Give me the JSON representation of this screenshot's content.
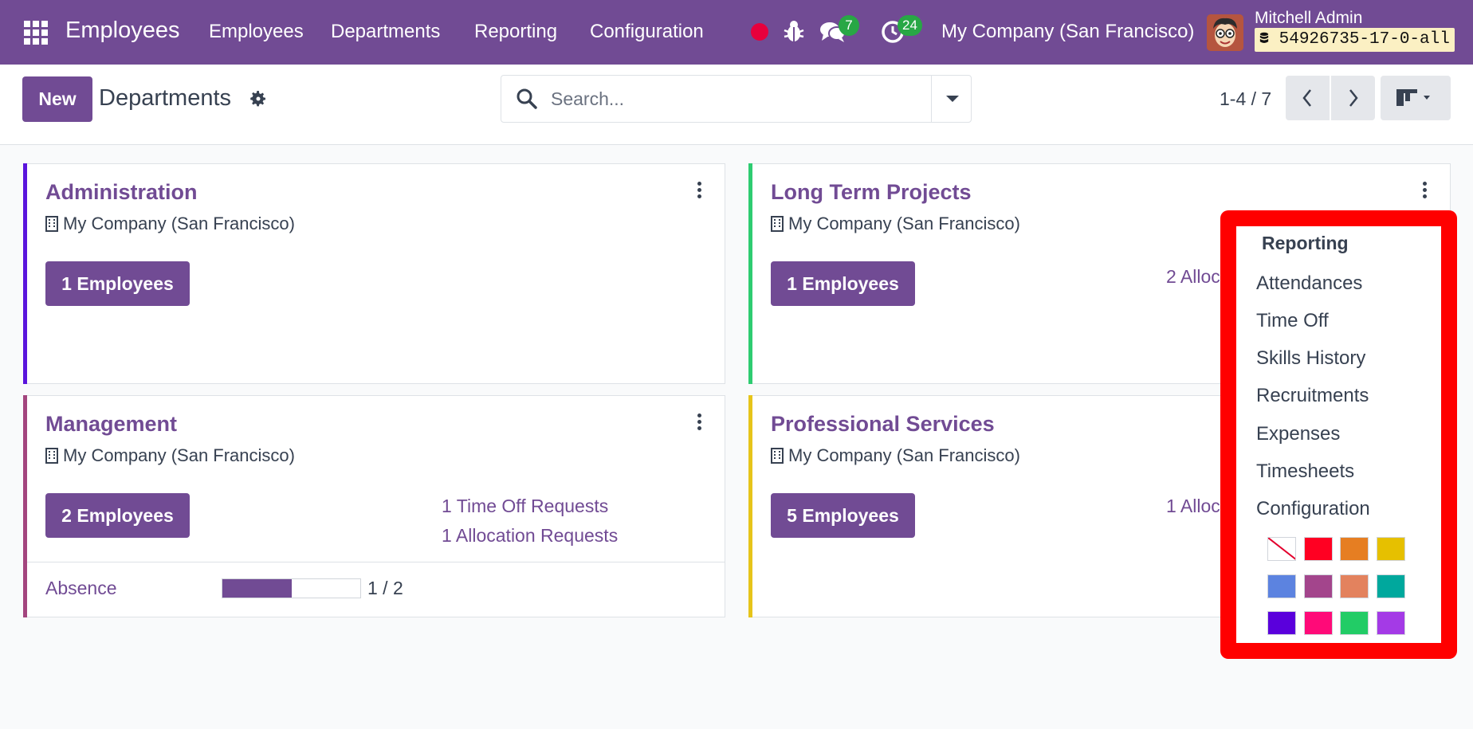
{
  "navbar": {
    "app_name": "Employees",
    "menu": [
      "Employees",
      "Departments",
      "Reporting",
      "Configuration"
    ],
    "messages_count": "7",
    "activities_count": "24",
    "company": "My Company (San Francisco)",
    "user_name": "Mitchell Admin",
    "database": "54926735-17-0-all",
    "icons": [
      "apps-icon",
      "record-dot-icon",
      "bug-icon",
      "chat-icon",
      "clock-icon",
      "database-icon"
    ]
  },
  "control_panel": {
    "new_label": "New",
    "title": "Departments",
    "search_placeholder": "Search...",
    "pager": "1-4 / 7"
  },
  "cards": [
    {
      "title": "Administration",
      "company": "My Company (San Francisco)",
      "employees_label": "1 Employees",
      "color": "#5a14dc"
    },
    {
      "title": "Long Term Projects",
      "company": "My Company (San Francisco)",
      "employees_label": "1 Employees",
      "link_1": "2 Alloc",
      "color": "#2ecc71"
    },
    {
      "title": "Management",
      "company": "My Company (San Francisco)",
      "employees_label": "2 Employees",
      "link_1": "1 Time Off Requests",
      "link_2": "1 Allocation Requests",
      "footer_label": "Absence",
      "progress_value": 1,
      "progress_max": 2,
      "progress_text": "1 / 2",
      "color": "#a3457e"
    },
    {
      "title": "Professional Services",
      "company": "My Company (San Francisco)",
      "employees_label": "5 Employees",
      "link_1": "1 Alloc",
      "color": "#e6c41a"
    }
  ],
  "dropdown": {
    "header": "Reporting",
    "items": [
      "Attendances",
      "Time Off",
      "Skills History",
      "Recruitments",
      "Expenses",
      "Timesheets",
      "Configuration"
    ],
    "colors": [
      "none",
      "#ff0022",
      "#e67e22",
      "#e6c000",
      "#5c83e0",
      "#a3458c",
      "#e3825e",
      "#00a89d",
      "#5a00dc",
      "#ff0a78",
      "#22cc66",
      "#a43ae6"
    ]
  },
  "theme": {
    "brand": "#714b94",
    "highlight_outline": "#ff0000"
  }
}
